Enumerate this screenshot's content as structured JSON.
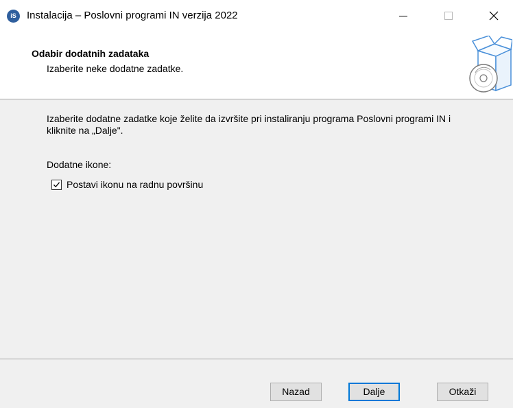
{
  "window": {
    "title": "Instalacija – Poslovni programi IN verzija 2022",
    "app_icon_text": "iS",
    "close_glyph": "✕"
  },
  "header": {
    "title": "Odabir dodatnih zadataka",
    "subtitle": "Izaberite neke dodatne zadatke."
  },
  "content": {
    "intro": "Izaberite dodatne zadatke koje želite da izvršite pri instaliranju programa Poslovni programi IN i kliknite na „Dalje\".",
    "section_label": "Dodatne ikone:",
    "checkbox": {
      "label": "Postavi ikonu na radnu površinu",
      "checked": true
    }
  },
  "buttons": {
    "back": "Nazad",
    "next": "Dalje",
    "cancel": "Otkaži"
  },
  "colors": {
    "accent": "#0078d7",
    "panel": "#f0f0f0",
    "app_icon": "#2f5f9e"
  }
}
